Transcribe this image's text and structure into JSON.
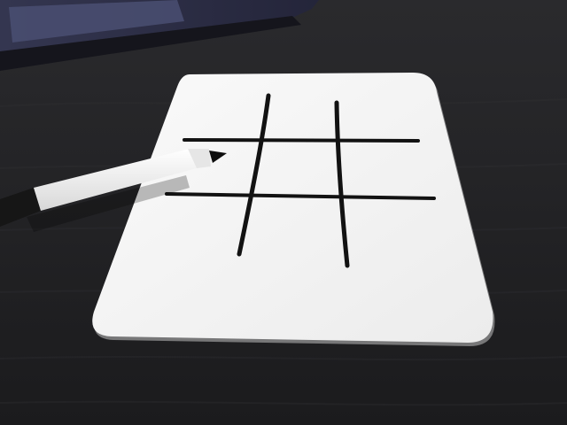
{
  "scene": {
    "colors": {
      "desk": "#232325",
      "desk_grain": "#2e2e31",
      "laptop_body": "#3b3f5a",
      "laptop_touchpad": "#4a4f72",
      "whiteboard": "#f4f4f4",
      "whiteboard_shadow": "#d9d9d9",
      "grid_ink": "#111111",
      "marker_barrel": "#f2f2f2",
      "marker_cap": "#151515"
    },
    "objects": [
      "laptop-corner",
      "whiteboard-card",
      "tic-tac-toe-grid",
      "dry-erase-marker"
    ]
  }
}
